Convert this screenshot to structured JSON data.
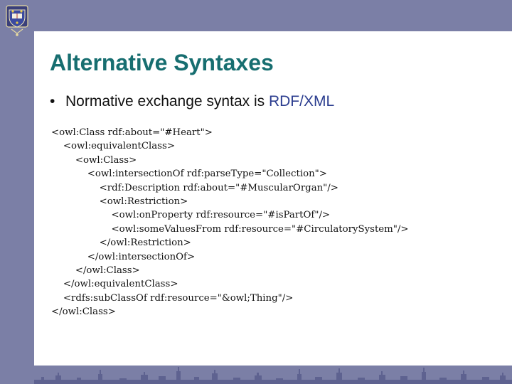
{
  "slide": {
    "title": "Alternative Syntaxes",
    "bullet": {
      "marker": "•",
      "text": "Normative exchange syntax is ",
      "highlight": "RDF/XML"
    },
    "code_lines": [
      "<owl:Class rdf:about=\"#Heart\">",
      "    <owl:equivalentClass>",
      "        <owl:Class>",
      "            <owl:intersectionOf rdf:parseType=\"Collection\">",
      "                <rdf:Description rdf:about=\"#MuscularOrgan\"/>",
      "                <owl:Restriction>",
      "                    <owl:onProperty rdf:resource=\"#isPartOf\"/>",
      "                    <owl:someValuesFrom rdf:resource=\"#CirculatorySystem\"/>",
      "                </owl:Restriction>",
      "            </owl:intersectionOf>",
      "        </owl:Class>",
      "    </owl:equivalentClass>",
      "    <rdfs:subClassOf rdf:resource=\"&owl;Thing\"/>",
      "</owl:Class>"
    ]
  },
  "decor": {
    "crest_icon": "university-crest-icon",
    "skyline_icon": "city-skyline-silhouette",
    "colors": {
      "frame": "#7b7fa6",
      "title": "#176e70",
      "highlight": "#2b3d8f",
      "skyline": "#5e6290"
    }
  }
}
